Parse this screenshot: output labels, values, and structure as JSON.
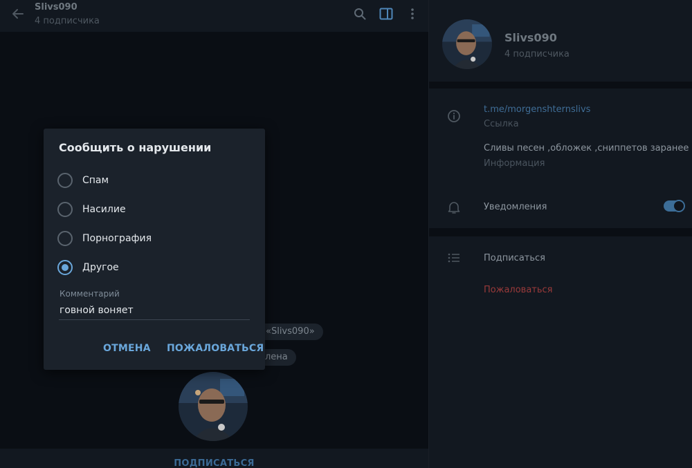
{
  "chat": {
    "title": "Slivs090",
    "subtitle": "4 подписчика",
    "service_msg_1": "«Slivs090»",
    "service_msg_2": "лена",
    "bottom_button": "ПОДПИСАТЬСЯ",
    "icons": [
      "back-arrow-icon",
      "search-icon",
      "sidebar-toggle-icon",
      "more-vertical-icon"
    ]
  },
  "info": {
    "name": "Slivs090",
    "subscribers": "4 подписчика",
    "link": "t.me/morgenshternslivs",
    "link_caption": "Ссылка",
    "description": "Сливы песен ,обложек ,сниппетов заранее",
    "description_caption": "Информация",
    "notifications_label": "Уведомления",
    "notifications_on": true,
    "subscribe_label": "Подписаться",
    "report_label": "Пожаловаться"
  },
  "dialog": {
    "title": "Сообщить о нарушении",
    "options": [
      {
        "label": "Спам",
        "selected": false
      },
      {
        "label": "Насилие",
        "selected": false
      },
      {
        "label": "Порнография",
        "selected": false
      },
      {
        "label": "Другое",
        "selected": true
      }
    ],
    "comment_label": "Комментарий",
    "comment_value": "говной воняет",
    "cancel_label": "ОТМЕНА",
    "submit_label": "ПОЖАЛОВАТЬСЯ"
  },
  "colors": {
    "accent": "#6aa7db",
    "danger": "#b43b3b",
    "link": "#3f6d96"
  }
}
